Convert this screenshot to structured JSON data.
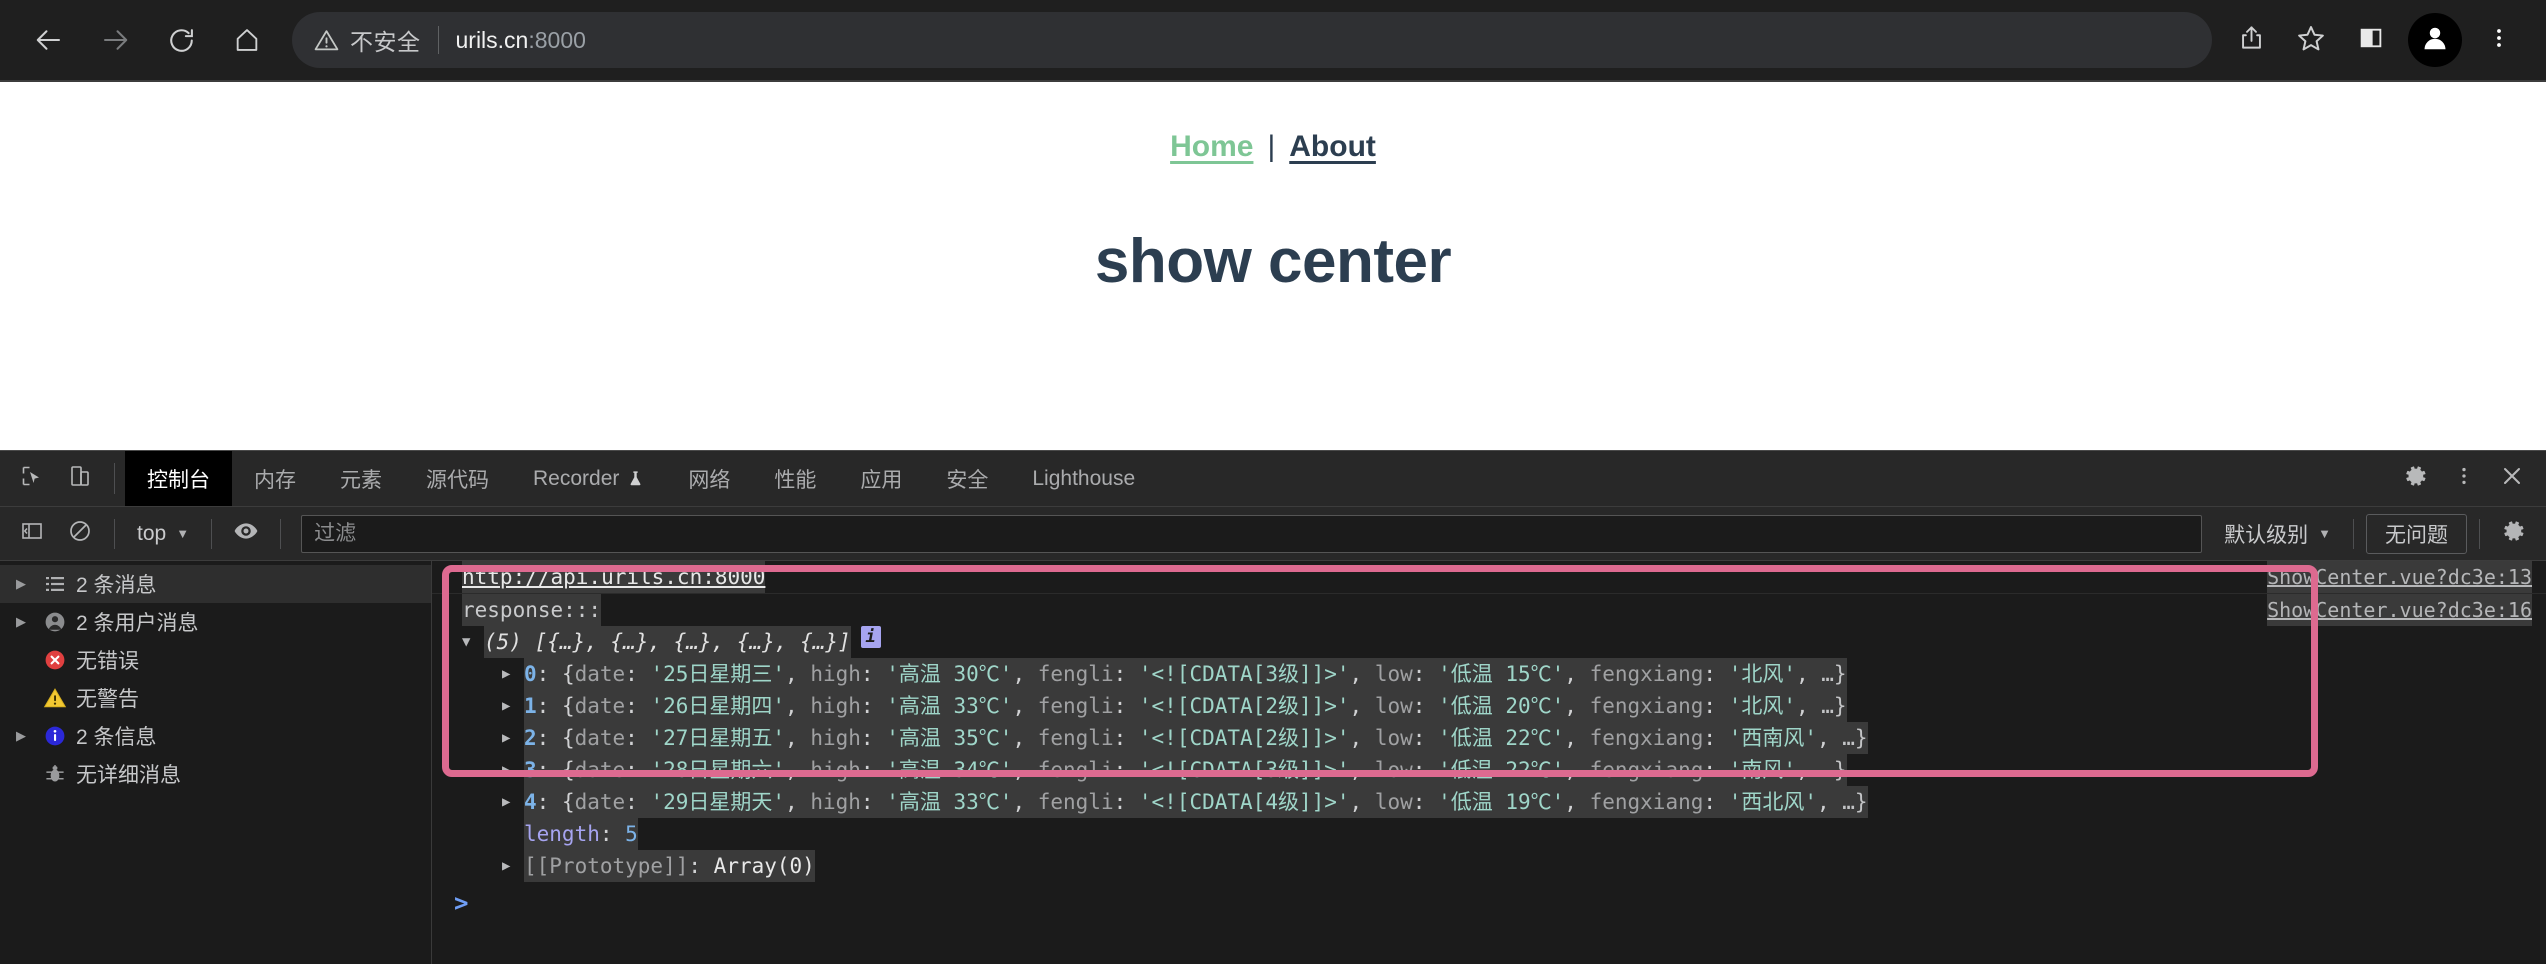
{
  "browser": {
    "back_icon": "arrow-left-icon",
    "forward_icon": "arrow-right-icon",
    "reload_icon": "reload-icon",
    "home_icon": "home-icon",
    "security_label": "不安全",
    "url_host": "urils.cn",
    "url_port": ":8000",
    "share_icon": "share-icon",
    "bookmark_icon": "star-icon",
    "sidepanel_icon": "side-panel-icon",
    "profile_icon": "profile-avatar-icon",
    "menu_icon": "three-dot-menu-icon"
  },
  "page": {
    "nav": {
      "home": "Home",
      "separator": "|",
      "about": "About"
    },
    "title": "show center",
    "colors": {
      "home_link": "#7ec695",
      "about_link": "#2c3e50",
      "title": "#2c3e50"
    }
  },
  "devtools": {
    "tabs": [
      {
        "label": "控制台",
        "active": true
      },
      {
        "label": "内存",
        "active": false
      },
      {
        "label": "元素",
        "active": false
      },
      {
        "label": "源代码",
        "active": false
      },
      {
        "label": "Recorder",
        "active": false,
        "badge_icon": "flask-icon"
      },
      {
        "label": "网络",
        "active": false
      },
      {
        "label": "性能",
        "active": false
      },
      {
        "label": "应用",
        "active": false
      },
      {
        "label": "安全",
        "active": false
      },
      {
        "label": "Lighthouse",
        "active": false
      }
    ],
    "toolbar_icons": {
      "inspect": "inspect-element-icon",
      "device": "device-toolbar-icon",
      "settings": "gear-icon",
      "more": "three-dot-menu-icon",
      "close": "close-icon"
    },
    "filterbar": {
      "sidebar_toggle_icon": "console-sidebar-toggle-icon",
      "clear_icon": "clear-console-icon",
      "context_label": "top",
      "eye_icon": "live-expression-icon",
      "filter_placeholder": "过滤",
      "filter_value": "",
      "levels_label": "默认级别",
      "issues_label": "无问题",
      "settings_icon": "gear-icon"
    },
    "sidebar": [
      {
        "label": "2 条消息",
        "icon": "list-icon",
        "expandable": true,
        "selected": true
      },
      {
        "label": "2 条用户消息",
        "icon": "user-icon",
        "expandable": true,
        "selected": false
      },
      {
        "label": "无错误",
        "icon": "error-icon",
        "expandable": false,
        "selected": false
      },
      {
        "label": "无警告",
        "icon": "warning-icon",
        "expandable": false,
        "selected": false
      },
      {
        "label": "2 条信息",
        "icon": "info-icon",
        "expandable": true,
        "selected": false
      },
      {
        "label": "无详细消息",
        "icon": "verbose-bug-icon",
        "expandable": false,
        "selected": false
      }
    ],
    "console": {
      "log_url": "http://api.urils.cn:8000",
      "log_url_source": "ShowCenter.vue?dc3e:13",
      "response_label": "response:::",
      "response_source": "ShowCenter.vue?dc3e:16",
      "array_preview": "(5) [{…}, {…}, {…}, {…}, {…}]",
      "info_badge": "i",
      "entries": [
        {
          "index": "0",
          "date": "25日星期三",
          "high": "高温 30℃",
          "fengli": "<![CDATA[3级]]>",
          "low": "低温 15℃",
          "fengxiang": "北风"
        },
        {
          "index": "1",
          "date": "26日星期四",
          "high": "高温 33℃",
          "fengli": "<![CDATA[2级]]>",
          "low": "低温 20℃",
          "fengxiang": "北风"
        },
        {
          "index": "2",
          "date": "27日星期五",
          "high": "高温 35℃",
          "fengli": "<![CDATA[2级]]>",
          "low": "低温 22℃",
          "fengxiang": "西南风"
        },
        {
          "index": "3",
          "date": "28日星期六",
          "high": "高温 34℃",
          "fengli": "<![CDATA[3级]]>",
          "low": "低温 22℃",
          "fengxiang": "南风"
        },
        {
          "index": "4",
          "date": "29日星期天",
          "high": "高温 33℃",
          "fengli": "<![CDATA[4级]]>",
          "low": "低温 19℃",
          "fengxiang": "西北风"
        }
      ],
      "keys": {
        "date": "date",
        "high": "high",
        "fengli": "fengli",
        "low": "low",
        "fengxiang": "fengxiang"
      },
      "length_key": "length",
      "length_value": "5",
      "prototype_key": "[[Prototype]]",
      "prototype_value": "Array(0)",
      "prompt_caret": ">",
      "highlight_color": "#dd6a90"
    }
  }
}
